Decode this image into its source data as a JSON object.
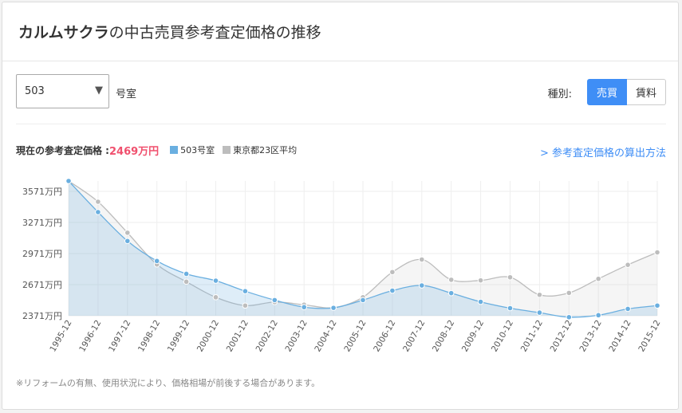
{
  "header": {
    "title_bold": "カルムサクラ",
    "title_rest": "の中古売買参考査定価格の推移"
  },
  "controls": {
    "room_select": "503",
    "room_suffix": "号室",
    "kind_label": "種別:",
    "buttons": [
      {
        "label": "売買",
        "active": true
      },
      {
        "label": "賃料",
        "active": false
      }
    ]
  },
  "legend_row": {
    "current_label": "現在の参考査定価格 :",
    "current_value": "2469万円",
    "method_link": "> 参考査定価格の算出方法"
  },
  "note": "※リフォームの有無、使用状況により、価格相場が前後する場合があります。",
  "colors": {
    "series_room": "#6aafe0",
    "series_avg": "#bdbdbd",
    "accent": "#3f8ef6",
    "price": "#f0506e"
  },
  "chart_data": {
    "type": "area",
    "x": [
      "1995-12",
      "1996-12",
      "1997-12",
      "1998-12",
      "1999-12",
      "2000-12",
      "2001-12",
      "2002-12",
      "2003-12",
      "2004-12",
      "2005-12",
      "2006-12",
      "2007-12",
      "2008-12",
      "2009-12",
      "2010-12",
      "2011-12",
      "2012-12",
      "2013-12",
      "2014-12",
      "2015-12"
    ],
    "series": [
      {
        "name": "503号室",
        "color": "#6aafe0",
        "values": [
          3671,
          3371,
          3092,
          2899,
          2775,
          2709,
          2608,
          2522,
          2454,
          2447,
          2522,
          2613,
          2663,
          2589,
          2505,
          2444,
          2401,
          2357,
          2376,
          2437,
          2469
        ]
      },
      {
        "name": "東京都23区平均",
        "color": "#bdbdbd",
        "values": [
          3671,
          3471,
          3172,
          2866,
          2699,
          2549,
          2469,
          2503,
          2477,
          2449,
          2549,
          2792,
          2913,
          2718,
          2712,
          2742,
          2573,
          2591,
          2727,
          2862,
          2982
        ]
      }
    ],
    "y_ticks": [
      "3571万円",
      "3271万円",
      "2971万円",
      "2671万円",
      "2371万円"
    ],
    "y_tick_values": [
      3571,
      3271,
      2971,
      2671,
      2371
    ],
    "ylim": [
      2371,
      3671
    ],
    "grid": true
  }
}
